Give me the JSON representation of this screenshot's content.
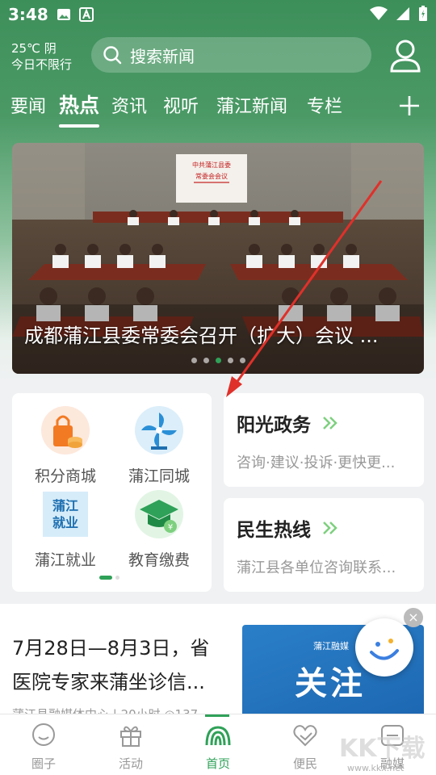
{
  "status_bar": {
    "time": "3:48"
  },
  "weather": {
    "temp": "25℃ 阴",
    "restriction": "今日不限行"
  },
  "search": {
    "placeholder": "搜索新闻"
  },
  "tabs": [
    {
      "label": "要闻"
    },
    {
      "label": "热点"
    },
    {
      "label": "资讯"
    },
    {
      "label": "视听"
    },
    {
      "label": "蒲江新闻"
    },
    {
      "label": "专栏"
    }
  ],
  "banner": {
    "title": "成都蒲江县委常委会召开（扩大）会议 ...",
    "screen_title": "中共蒲江县委",
    "screen_subtitle": "常委会会议",
    "slide_count": 5,
    "active_slide": 3
  },
  "services": [
    {
      "label": "积分商城",
      "icon": "shopping-bag-icon"
    },
    {
      "label": "蒲江同城",
      "icon": "windmill-icon"
    },
    {
      "label": "蒲江就业",
      "icon": "employment-icon"
    },
    {
      "label": "教育缴费",
      "icon": "graduation-cap-icon"
    }
  ],
  "side_cards": [
    {
      "title": "阳光政务",
      "subtitle": "咨询·建议·投诉·更快更..."
    },
    {
      "title": "民生热线",
      "subtitle": "蒲江县各单位咨询联系..."
    }
  ],
  "news": {
    "title": "7月28日—8月3日，省医院专家来蒲坐诊信...",
    "meta": "蒲江县融媒体中心 | 20小时 ◎137",
    "thumb_brand": "蒲江融媒",
    "thumb_text": "关注"
  },
  "close_glyph": "×",
  "bottom_nav": [
    {
      "label": "圈子"
    },
    {
      "label": "活动"
    },
    {
      "label": "首页"
    },
    {
      "label": "便民"
    },
    {
      "label": "融媒"
    }
  ],
  "watermark": {
    "text": "KK下载",
    "url": "www.kkx.net"
  },
  "colors": {
    "brand_green": "#2fa158",
    "header_green": "#3d8f5a",
    "annotation_arrow": "#e0302a"
  }
}
